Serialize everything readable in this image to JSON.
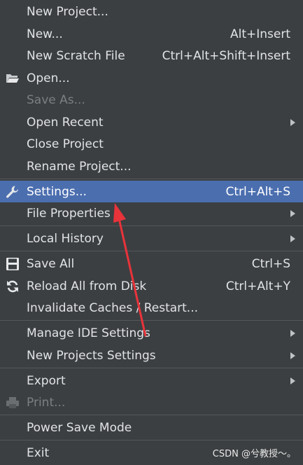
{
  "menu": {
    "items": [
      {
        "label": "New Project..."
      },
      {
        "label": "New...",
        "shortcut": "Alt+Insert"
      },
      {
        "label": "New Scratch File",
        "shortcut": "Ctrl+Alt+Shift+Insert"
      },
      {
        "label": "Open...",
        "icon": "folder-open-icon"
      },
      {
        "label": "Save As..."
      },
      {
        "label": "Open Recent"
      },
      {
        "label": "Close Project"
      },
      {
        "label": "Rename Project..."
      },
      {
        "label": "Settings...",
        "shortcut": "Ctrl+Alt+S",
        "icon": "wrench-icon"
      },
      {
        "label": "File Properties"
      },
      {
        "label": "Local History"
      },
      {
        "label": "Save All",
        "shortcut": "Ctrl+S",
        "icon": "save-icon"
      },
      {
        "label": "Reload All from Disk",
        "shortcut": "Ctrl+Alt+Y",
        "icon": "reload-icon"
      },
      {
        "label": "Invalidate Caches / Restart..."
      },
      {
        "label": "Manage IDE Settings"
      },
      {
        "label": "New Projects Settings"
      },
      {
        "label": "Export"
      },
      {
        "label": "Print...",
        "icon": "printer-icon"
      },
      {
        "label": "Power Save Mode"
      },
      {
        "label": "Exit"
      }
    ]
  },
  "watermark": "CSDN @兮教授～。",
  "colors": {
    "background": "#3c3f41",
    "selection": "#4b6eaf",
    "annotation_arrow": "#e8333b"
  }
}
